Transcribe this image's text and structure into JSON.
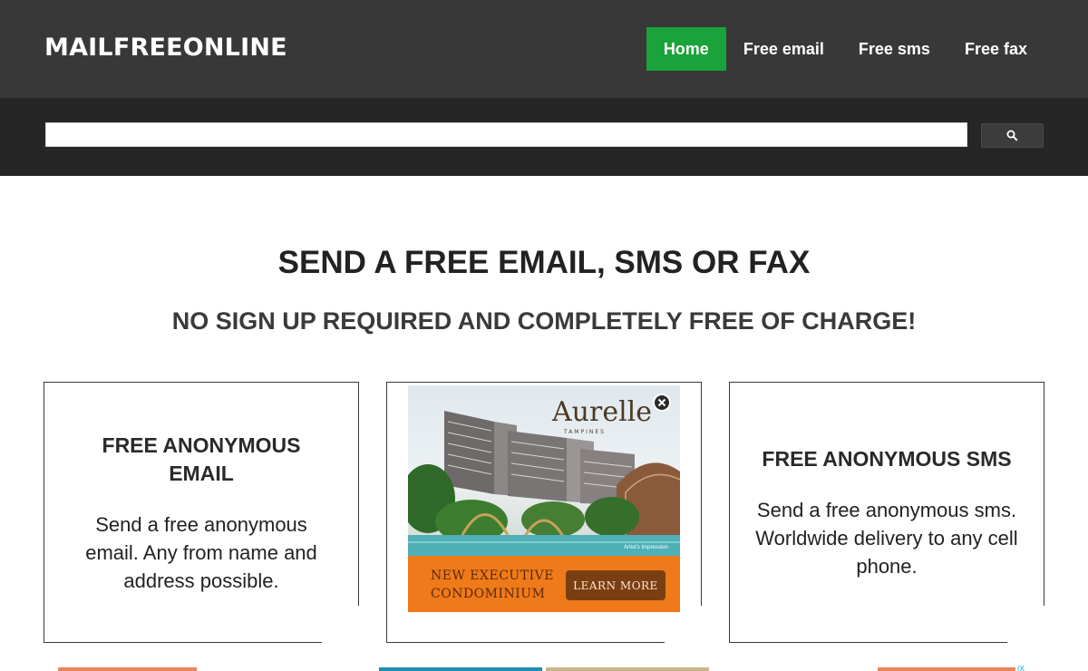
{
  "header": {
    "logo": "MAILFREEONLINE",
    "nav": [
      {
        "label": "Home",
        "active": true
      },
      {
        "label": "Free email",
        "active": false
      },
      {
        "label": "Free sms",
        "active": false
      },
      {
        "label": "Free fax",
        "active": false
      }
    ],
    "colors": {
      "bar": "#383838",
      "active": "#1aa33a"
    }
  },
  "search": {
    "value": "",
    "button_icon": "search-icon"
  },
  "hero": {
    "title": "SEND A FREE EMAIL, SMS OR FAX",
    "subtitle": "NO SIGN UP REQUIRED AND COMPLETELY FREE OF CHARGE!"
  },
  "cards": [
    {
      "title": "FREE ANONYMOUS EMAIL",
      "text": "Send a free anonymous email. Any from name and address possible."
    },
    {
      "title": "FREE ANONYMOUS SMS",
      "text": "Send a free anonymous sms. Worldwide delivery to any cell phone."
    }
  ],
  "ad": {
    "brand": "Aurelle",
    "brand_sub": "TAMPINES",
    "credit": "Artist's Impression",
    "tagline": "NEW EXECUTIVE CONDOMINIUM",
    "cta": "LEARN MORE",
    "close_icon": "close-icon",
    "colors": {
      "band": "#ef7a1a",
      "cta": "#7a3e12"
    }
  },
  "footer_ad_marker": "(X"
}
